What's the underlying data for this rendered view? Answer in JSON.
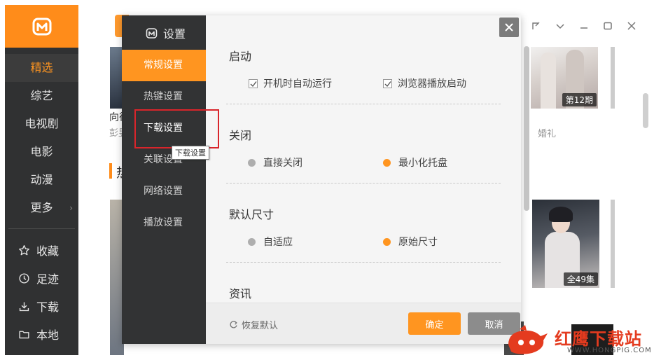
{
  "colors": {
    "accent": "#ff9520",
    "sidebar_bg": "#303132",
    "dialog_nav_bg": "#323334",
    "annotation": "#d9252b"
  },
  "sidebar": {
    "nav": [
      {
        "label": "精选",
        "active": true
      },
      {
        "label": "综艺"
      },
      {
        "label": "电视剧"
      },
      {
        "label": "电影"
      },
      {
        "label": "动漫"
      },
      {
        "label": "更多"
      }
    ],
    "tools": [
      {
        "label": "收藏",
        "icon": "star-icon"
      },
      {
        "label": "足迹",
        "icon": "clock-icon"
      },
      {
        "label": "下载",
        "icon": "download-icon"
      },
      {
        "label": "本地",
        "icon": "folder-icon"
      }
    ]
  },
  "background": {
    "card_left_title": "向往",
    "card_left_sub": "彭昱",
    "episode_badge_1": "第12期",
    "card_right_sub": "婚礼",
    "episode_badge_2": "全49集",
    "section_title": "热"
  },
  "dialog": {
    "title": "设置",
    "nav": [
      {
        "label": "常规设置",
        "active": true
      },
      {
        "label": "热键设置"
      },
      {
        "label": "下载设置",
        "hover": true
      },
      {
        "label": "关联设置"
      },
      {
        "label": "网络设置"
      },
      {
        "label": "播放设置"
      }
    ],
    "tooltip": "下载设置",
    "sections": {
      "startup": {
        "title": "启动",
        "opt1": {
          "label": "开机时自动运行",
          "checked": true
        },
        "opt2": {
          "label": "浏览器播放启动",
          "checked": true
        }
      },
      "close": {
        "title": "关闭",
        "opt1": {
          "label": "直接关闭",
          "selected": false
        },
        "opt2": {
          "label": "最小化托盘",
          "selected": true
        }
      },
      "size": {
        "title": "默认尺寸",
        "opt1": {
          "label": "自适应",
          "selected": false
        },
        "opt2": {
          "label": "原始尺寸",
          "selected": true
        }
      },
      "news": {
        "title": "资讯"
      }
    },
    "footer": {
      "restore_label": "恢复默认",
      "ok_label": "确定",
      "cancel_label": "取消"
    }
  },
  "watermark": {
    "text": "红鹰下载站",
    "url": "WWW.HONGPIG.COM"
  }
}
